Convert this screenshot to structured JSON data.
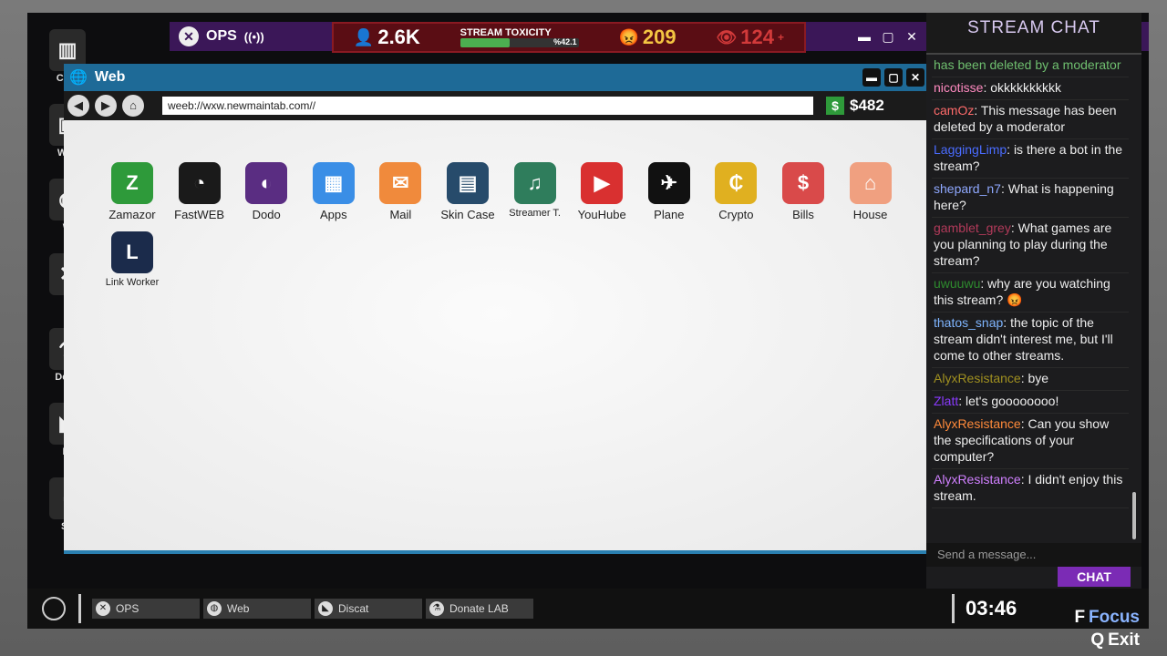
{
  "topbar": {
    "ops_label": "OPS",
    "viewers": "2.6K",
    "toxicity_label": "STREAM TOXICITY",
    "toxicity_pct": "%42.1",
    "toxicity_fraction": 0.421,
    "subs": "209",
    "watching": "124",
    "watching_suffix": "+"
  },
  "desktop": {
    "items": [
      {
        "label": "Com",
        "icon": "computer-icon"
      },
      {
        "label": "Wall",
        "icon": "wallet-icon"
      },
      {
        "label": "W",
        "icon": "web-icon"
      },
      {
        "label": "O",
        "icon": "ops-icon"
      },
      {
        "label": "Dona",
        "icon": "flask-icon"
      },
      {
        "label": "Di",
        "icon": "cat-icon"
      },
      {
        "label": "Sn",
        "icon": "snap-icon"
      }
    ]
  },
  "web": {
    "title": "Web",
    "url": "weeb://wxw.newmaintab.com//",
    "balance": "$482",
    "apps": [
      {
        "name": "Zamazor",
        "glyph": "Z",
        "color": "#2e9a3a"
      },
      {
        "name": "FastWEB",
        "glyph": "◔",
        "color": "#1a1a1a"
      },
      {
        "name": "Dodo",
        "glyph": "◐",
        "color": "#5a2d82"
      },
      {
        "name": "Apps",
        "glyph": "▦",
        "color": "#3a8ee6"
      },
      {
        "name": "Mail",
        "glyph": "✉",
        "color": "#f08a3c"
      },
      {
        "name": "Skin Case",
        "glyph": "▤",
        "color": "#274b6b"
      },
      {
        "name": "Streamer T.",
        "glyph": "♫",
        "color": "#2f7d5c"
      },
      {
        "name": "YouHube",
        "glyph": "▶",
        "color": "#d93030"
      },
      {
        "name": "Plane",
        "glyph": "✈",
        "color": "#111111"
      },
      {
        "name": "Crypto",
        "glyph": "₵",
        "color": "#e0b020"
      },
      {
        "name": "Bills",
        "glyph": "$",
        "color": "#d94a4a"
      },
      {
        "name": "House",
        "glyph": "⌂",
        "color": "#f0a080"
      },
      {
        "name": "Link Worker",
        "glyph": "L",
        "color": "#1b2b4b"
      }
    ]
  },
  "chat": {
    "title": "STREAM CHAT",
    "messages": [
      {
        "user": "",
        "text": "has been deleted by a moderator",
        "ucolor": "#6fbf6f"
      },
      {
        "user": "nicotisse",
        "text": ": okkkkkkkkkk",
        "ucolor": "#ff8ac0"
      },
      {
        "user": "camOz",
        "text": ": This message has been deleted by a moderator",
        "ucolor": "#ff6b6b"
      },
      {
        "user": "LaggingLimp",
        "text": ": is there a bot in the stream?",
        "ucolor": "#4a6cff"
      },
      {
        "user": "shepard_n7",
        "text": ": What is happening here?",
        "ucolor": "#8fa8ff"
      },
      {
        "user": "gamblet_grey",
        "text": ": What games are you planning to play during the stream?",
        "ucolor": "#b23a5a"
      },
      {
        "user": "uwuuwu",
        "text": ": why are you watching this stream? 😡",
        "ucolor": "#2e8b2e"
      },
      {
        "user": "thatos_snap",
        "text": ": the topic of the stream didn't interest me, but I'll come to other streams.",
        "ucolor": "#7fb5ff"
      },
      {
        "user": "AlyxResistance",
        "text": ": bye",
        "ucolor": "#a09020"
      },
      {
        "user": "Zlatt",
        "text": ": let's goooooooo!",
        "ucolor": "#8a3aff"
      },
      {
        "user": "AlyxResistance",
        "text": ": Can you show the specifications of your computer?",
        "ucolor": "#ff8a3a"
      },
      {
        "user": "AlyxResistance",
        "text": ": I didn't enjoy this stream.",
        "ucolor": "#d080ff"
      }
    ],
    "input_placeholder": "Send a message...",
    "send_label": "CHAT"
  },
  "taskbar": {
    "items": [
      {
        "label": "OPS",
        "icon": "ops-icon"
      },
      {
        "label": "Web",
        "icon": "web-icon"
      },
      {
        "label": "Discat",
        "icon": "cat-icon"
      },
      {
        "label": "Donate LAB",
        "icon": "flask-icon"
      }
    ],
    "clock": "03:46"
  },
  "hints": {
    "focus_key": "F",
    "focus_label": "Focus",
    "exit_key": "Q",
    "exit_label": "Exit"
  }
}
